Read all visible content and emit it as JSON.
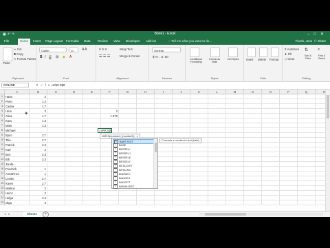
{
  "window": {
    "title": "Book1 - Excel",
    "qat_icons": [
      "save-icon",
      "undo-icon",
      "redo-icon"
    ],
    "controls": [
      "minimize-icon",
      "restore-icon",
      "close-icon"
    ]
  },
  "tabs": [
    "File",
    "Home",
    "Insert",
    "Page Layout",
    "Formulas",
    "Data",
    "Review",
    "View",
    "Developer",
    "Add-ins"
  ],
  "active_tab": "Home",
  "tell_me": "Tell me what you want to do...",
  "user": {
    "name": "Fiorek, Jens",
    "share": "Share"
  },
  "ribbon": {
    "clipboard": {
      "paste": "Paste",
      "cut": "Cut",
      "copy": "Copy",
      "format_painter": "Format Painter",
      "label": "Clipboard"
    },
    "font": {
      "family": "Calibri",
      "size": "11",
      "label": "Font"
    },
    "alignment": {
      "wrap": "Wrap Text",
      "merge": "Merge & Center",
      "label": "Alignment"
    },
    "number": {
      "format": "General",
      "label": "Number"
    },
    "styles": {
      "conditional": "Conditional Formatting",
      "table": "Format as Table",
      "cell": "Cell Styles",
      "label": "Styles"
    },
    "cells": {
      "insert": "Insert",
      "delete": "Delete",
      "format": "Format",
      "label": "Cells"
    },
    "editing": {
      "autosum": "AutoSum",
      "fill": "Fill",
      "clear": "Clear",
      "sort": "Sort & Filter",
      "find": "Find & Select",
      "label": "Editing"
    }
  },
  "formula_bar": {
    "name_box": "COLINE",
    "content": "=VAR.S(B"
  },
  "columns": [
    "A",
    "B",
    "C",
    "D",
    "E",
    "F",
    "G",
    "H",
    "I",
    "J",
    "K",
    "L",
    "M",
    "N",
    "O",
    "P",
    "Q",
    "R",
    "S",
    "T"
  ],
  "rows": [
    "1",
    "2",
    "3",
    "4",
    "5",
    "6",
    "7",
    "8",
    "9",
    "10",
    "11",
    "12",
    "13",
    "14",
    "15",
    "16",
    "17",
    "18",
    "19",
    "20",
    "21",
    "22",
    "23"
  ],
  "cells": {
    "A": [
      "Hans",
      "Peter",
      "Carina",
      "Uma",
      "Alina",
      "Kara",
      "Mats",
      "Michael",
      "Bjorn",
      "Tilia",
      "Patrick",
      "Karl",
      "Ben",
      "Bill",
      "Jonda",
      "Friedrich",
      "AnnaFinec",
      "Lemke",
      "Karen",
      "Markus",
      "Heinz",
      "Helga",
      "Olga",
      "Hamm"
    ],
    "B": [
      "2",
      "1.2",
      "1.7",
      "2",
      "1.7",
      "1.3",
      "1.3",
      "",
      "3.7",
      "2.7",
      "2.3",
      "2",
      "3.3",
      "3.3",
      "",
      "1",
      "1",
      "2.7",
      "2.7",
      "2",
      "2",
      "3.3",
      "2",
      "2.3"
    ],
    "F5": "2",
    "F6": "1.072",
    "G5": "=VAR.S(B"
  },
  "tooltip": "VAR.S(number1, [number2], ...)",
  "autocomplete": {
    "items": [
      "BAHTTEXT",
      "BASE",
      "BESSELI",
      "BESSELJ",
      "BESSELK",
      "BESSELY",
      "BETA.DIST",
      "BETA.INV",
      "BIN2DEC",
      "BIN2HEX",
      "BIN2OCT",
      "BINOM.DIST"
    ],
    "selected_index": 0,
    "tip": "Converts a number to text (baht)"
  },
  "sheet": {
    "tab": "Sheet1"
  }
}
